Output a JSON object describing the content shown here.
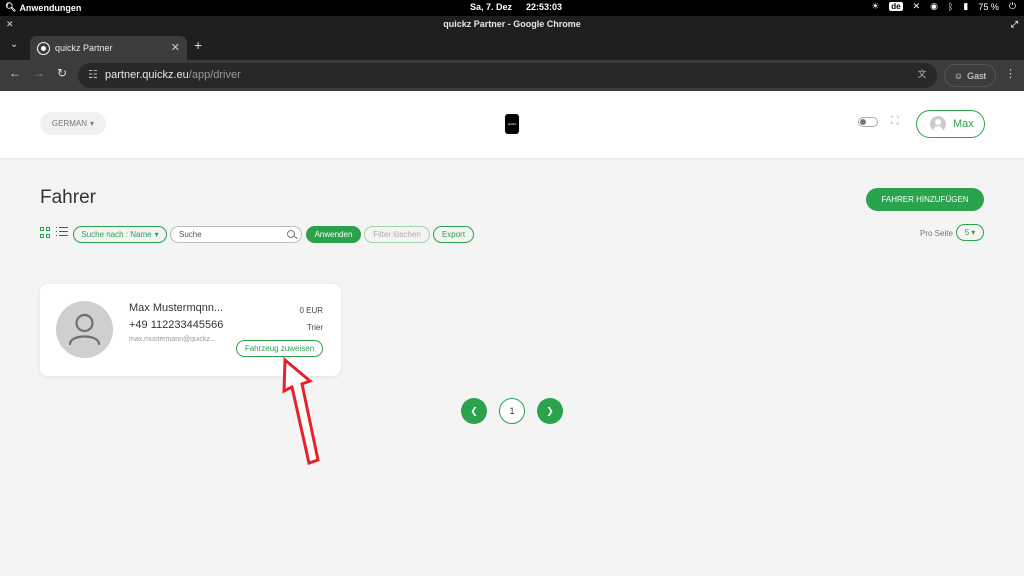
{
  "os": {
    "apps_label": "Anwendungen",
    "date": "Sa, 7. Dez",
    "time": "22:53:03",
    "keyboard_layout": "de",
    "battery": "75 %"
  },
  "browser": {
    "window_title": "quickz Partner - Google Chrome",
    "tab_title": "quickz Partner",
    "url_host": "partner.quickz.eu",
    "url_path": "/app/driver",
    "profile_label": "Gast"
  },
  "header": {
    "language": "GERMAN",
    "logo_text": "quickz",
    "user_name": "Max"
  },
  "page": {
    "title": "Fahrer",
    "add_button": "FAHRER HINZUFÜGEN"
  },
  "toolbar": {
    "search_by": "Suche nach : Name",
    "search_placeholder": "Suche",
    "apply": "Anwenden",
    "clear": "Filter löschen",
    "export": "Export",
    "per_page_label": "Pro Seite",
    "per_page_value": "5"
  },
  "drivers": [
    {
      "name": "Max Mustermqnn...",
      "phone": "+49 112233445566",
      "email": "max.mustermann@quickz...",
      "balance": "0 EUR",
      "city": "Trier",
      "assign_vehicle": "Fahrzeug zuweisen"
    }
  ],
  "pagination": {
    "current": "1"
  },
  "colors": {
    "accent": "#2ba24c",
    "annotation_arrow": "#e8202a"
  }
}
